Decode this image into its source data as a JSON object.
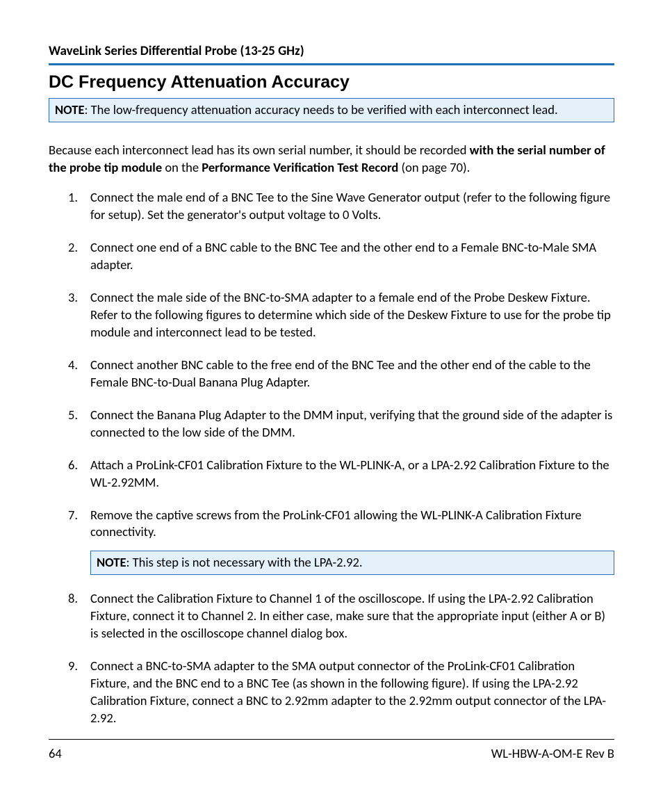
{
  "header": {
    "running": "WaveLink Series Differential Probe (13-25 GHz)"
  },
  "title": "DC Frequency Attenuation Accuracy",
  "note1": {
    "label": "NOTE",
    "text": ": The low-frequency attenuation accuracy needs to be verified with each interconnect lead."
  },
  "intro": {
    "pre": "Because each interconnect lead has its own serial number, it should be recorded ",
    "bold1": "with the serial number of the probe tip module",
    "mid": " on the ",
    "bold2": "Performance Verification Test Record",
    "post": " (on page 70)."
  },
  "steps": [
    " Connect the male end of a BNC Tee to the Sine Wave Generator output (refer to the following figure for setup). Set the generator's output voltage to 0 Volts.",
    "Connect one end of a BNC cable to the BNC Tee and the other end to a Female BNC-to-Male SMA adapter.",
    "Connect the male side of the BNC-to-SMA adapter to a female end of the Probe Deskew Fixture. Refer to the following figures to determine which side of the Deskew Fixture to use for the probe tip module and interconnect lead to be tested.",
    "Connect another BNC cable to the free end of the BNC Tee and the other end of the cable to the Female BNC-to-Dual Banana Plug Adapter.",
    "Connect the Banana Plug Adapter to the DMM input, verifying that the ground side of the adapter is connected to the low side of the DMM.",
    "Attach a ProLink-CF01 Calibration Fixture to the WL-PLINK-A, or a LPA-2.92 Calibration Fixture to the WL-2.92MM.",
    "Remove the captive screws from the ProLink-CF01 allowing the WL-PLINK-A Calibration Fixture connectivity.",
    "Connect the Calibration Fixture to Channel 1 of the oscilloscope. If using the LPA-2.92 Calibration Fixture, connect it to Channel 2. In either case, make sure that the appropriate input (either A or B) is selected in the oscilloscope channel dialog box.",
    "Connect a BNC-to-SMA adapter to the SMA output connector of the ProLink-CF01 Calibration Fixture, and the BNC end to a BNC Tee (as shown in the following figure). If using the LPA-2.92 Calibration Fixture, connect a BNC to 2.92mm adapter to the 2.92mm output connector of the LPA-2.92."
  ],
  "step7_note": {
    "label": "NOTE",
    "text": ": This step is not necessary with the LPA-2.92."
  },
  "footer": {
    "page": "64",
    "doc": "WL-HBW-A-OM-E Rev B"
  }
}
